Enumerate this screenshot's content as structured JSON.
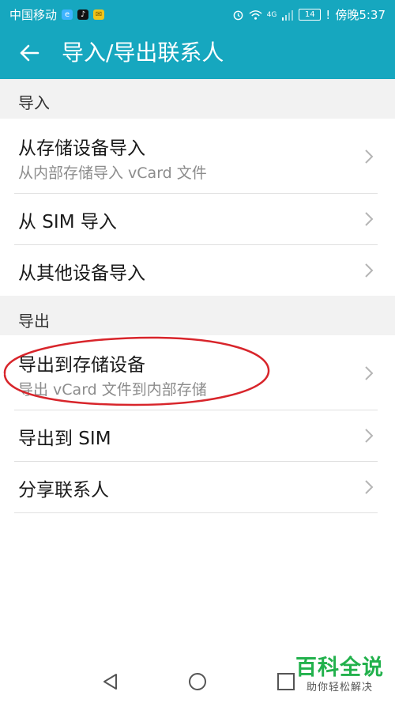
{
  "status_bar": {
    "carrier": "中国移动",
    "network": "4G",
    "battery": "14",
    "alert": "!",
    "time": "傍晚5:37"
  },
  "app_bar": {
    "title": "导入/导出联系人",
    "back_icon": "arrow-left-icon"
  },
  "import_section": {
    "header": "导入",
    "items": [
      {
        "title": "从存储设备导入",
        "subtitle": "从内部存储导入 vCard 文件"
      },
      {
        "title": "从 SIM 导入"
      },
      {
        "title": "从其他设备导入"
      }
    ]
  },
  "export_section": {
    "header": "导出",
    "items": [
      {
        "title": "导出到存储设备",
        "subtitle": "导出 vCard 文件到内部存储"
      },
      {
        "title": "导出到 SIM"
      },
      {
        "title": "分享联系人"
      }
    ]
  },
  "nav_bar": {
    "back_icon": "triangle-back-icon",
    "home_icon": "circle-home-icon",
    "recents_icon": "square-recents-icon"
  },
  "watermark": {
    "title": "百科全说",
    "subtitle": "助你轻松解决"
  },
  "colors": {
    "primary": "#16a7bf",
    "annotation": "#d8252b",
    "watermark": "#22b14c"
  }
}
